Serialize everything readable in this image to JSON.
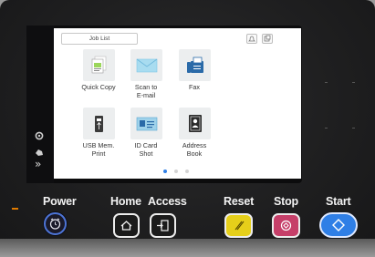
{
  "screen": {
    "job_list_label": "Job List",
    "top_icons": [
      "bell-icon",
      "copy-status-icon"
    ],
    "tiles": [
      {
        "label": "Quick Copy",
        "icon": "quick-copy-icon"
      },
      {
        "label": "Scan to E-mail",
        "line1": "Scan to",
        "line2": "E-mail",
        "icon": "email-envelope-icon"
      },
      {
        "label": "Fax",
        "icon": "fax-icon"
      },
      {
        "label": "USB Mem. Print",
        "line1": "USB Mem.",
        "line2": "Print",
        "icon": "usb-icon"
      },
      {
        "label": "ID Card Shot",
        "line1": "ID Card",
        "line2": "Shot",
        "icon": "id-card-icon"
      },
      {
        "label": "Address Book",
        "line1": "Address",
        "line2": "Book",
        "icon": "address-book-icon"
      }
    ],
    "page_indicator": {
      "pages": 3,
      "current": 1
    }
  },
  "sidebar": {
    "icons": [
      "settings-icon",
      "accessibility-icon",
      "expand-icon"
    ],
    "expand_glyph": "»"
  },
  "buttons": {
    "power": "Power",
    "home": "Home",
    "access": "Access",
    "reset": "Reset",
    "stop": "Stop",
    "start": "Start"
  },
  "colors": {
    "reset": "#e8d21e",
    "stop": "#c8406a",
    "start": "#2f7fe6",
    "power": "#3b63c9",
    "power_indicator": "#e07b00"
  }
}
